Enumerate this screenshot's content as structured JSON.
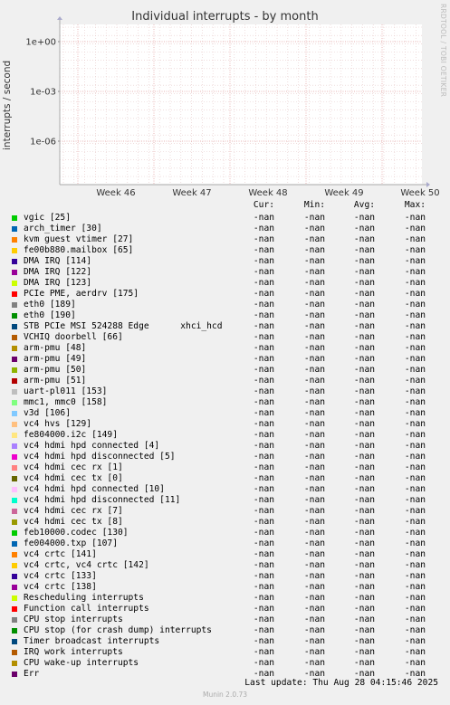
{
  "chart_data": {
    "type": "line",
    "title": "Individual interrupts - by month",
    "ylabel": "interrupts / second",
    "yscale": "log",
    "y_ticks": [
      "1e+00",
      "1e-03",
      "1e-06"
    ],
    "x_ticks": [
      "Week 46",
      "Week 47",
      "Week 48",
      "Week 49",
      "Week 50"
    ],
    "grid": true,
    "series": []
  },
  "side_label": "RRDTOOL / TOBI OETIKER",
  "legend_headers": [
    "Cur:",
    "Min:",
    "Avg:",
    "Max:"
  ],
  "legend": [
    {
      "name": "vgic [25]",
      "color": "#00cc00",
      "cur": "-nan",
      "min": "-nan",
      "avg": "-nan",
      "max": "-nan"
    },
    {
      "name": "arch_timer [30]",
      "color": "#0066b3",
      "cur": "-nan",
      "min": "-nan",
      "avg": "-nan",
      "max": "-nan"
    },
    {
      "name": "kvm guest vtimer [27]",
      "color": "#ff8000",
      "cur": "-nan",
      "min": "-nan",
      "avg": "-nan",
      "max": "-nan"
    },
    {
      "name": "fe00b880.mailbox [65]",
      "color": "#ffcc00",
      "cur": "-nan",
      "min": "-nan",
      "avg": "-nan",
      "max": "-nan"
    },
    {
      "name": "DMA IRQ [114]",
      "color": "#330099",
      "cur": "-nan",
      "min": "-nan",
      "avg": "-nan",
      "max": "-nan"
    },
    {
      "name": "DMA IRQ [122]",
      "color": "#990099",
      "cur": "-nan",
      "min": "-nan",
      "avg": "-nan",
      "max": "-nan"
    },
    {
      "name": "DMA IRQ [123]",
      "color": "#ccff00",
      "cur": "-nan",
      "min": "-nan",
      "avg": "-nan",
      "max": "-nan"
    },
    {
      "name": "PCIe PME, aerdrv [175]",
      "color": "#ff0000",
      "cur": "-nan",
      "min": "-nan",
      "avg": "-nan",
      "max": "-nan"
    },
    {
      "name": "eth0 [189]",
      "color": "#808080",
      "cur": "-nan",
      "min": "-nan",
      "avg": "-nan",
      "max": "-nan"
    },
    {
      "name": "eth0 [190]",
      "color": "#008f00",
      "cur": "-nan",
      "min": "-nan",
      "avg": "-nan",
      "max": "-nan"
    },
    {
      "name": "STB PCIe MSI 524288 Edge      xhci_hcd",
      "color": "#00487d",
      "cur": "-nan",
      "min": "-nan",
      "avg": "-nan",
      "max": "-nan"
    },
    {
      "name": "VCHIQ doorbell [66]",
      "color": "#b35a00",
      "cur": "-nan",
      "min": "-nan",
      "avg": "-nan",
      "max": "-nan"
    },
    {
      "name": "arm-pmu [48]",
      "color": "#b38f00",
      "cur": "-nan",
      "min": "-nan",
      "avg": "-nan",
      "max": "-nan"
    },
    {
      "name": "arm-pmu [49]",
      "color": "#6b006b",
      "cur": "-nan",
      "min": "-nan",
      "avg": "-nan",
      "max": "-nan"
    },
    {
      "name": "arm-pmu [50]",
      "color": "#8fb300",
      "cur": "-nan",
      "min": "-nan",
      "avg": "-nan",
      "max": "-nan"
    },
    {
      "name": "arm-pmu [51]",
      "color": "#b30000",
      "cur": "-nan",
      "min": "-nan",
      "avg": "-nan",
      "max": "-nan"
    },
    {
      "name": "uart-pl011 [153]",
      "color": "#bebebe",
      "cur": "-nan",
      "min": "-nan",
      "avg": "-nan",
      "max": "-nan"
    },
    {
      "name": "mmc1, mmc0 [158]",
      "color": "#80ff80",
      "cur": "-nan",
      "min": "-nan",
      "avg": "-nan",
      "max": "-nan"
    },
    {
      "name": "v3d [106]",
      "color": "#80c9ff",
      "cur": "-nan",
      "min": "-nan",
      "avg": "-nan",
      "max": "-nan"
    },
    {
      "name": "vc4 hvs [129]",
      "color": "#ffc080",
      "cur": "-nan",
      "min": "-nan",
      "avg": "-nan",
      "max": "-nan"
    },
    {
      "name": "fe804000.i2c [149]",
      "color": "#ffe680",
      "cur": "-nan",
      "min": "-nan",
      "avg": "-nan",
      "max": "-nan"
    },
    {
      "name": "vc4 hdmi hpd connected [4]",
      "color": "#aa80ff",
      "cur": "-nan",
      "min": "-nan",
      "avg": "-nan",
      "max": "-nan"
    },
    {
      "name": "vc4 hdmi hpd disconnected [5]",
      "color": "#ee00cc",
      "cur": "-nan",
      "min": "-nan",
      "avg": "-nan",
      "max": "-nan"
    },
    {
      "name": "vc4 hdmi cec rx [1]",
      "color": "#ff8080",
      "cur": "-nan",
      "min": "-nan",
      "avg": "-nan",
      "max": "-nan"
    },
    {
      "name": "vc4 hdmi cec tx [0]",
      "color": "#666600",
      "cur": "-nan",
      "min": "-nan",
      "avg": "-nan",
      "max": "-nan"
    },
    {
      "name": "vc4 hdmi hpd connected [10]",
      "color": "#ffbfff",
      "cur": "-nan",
      "min": "-nan",
      "avg": "-nan",
      "max": "-nan"
    },
    {
      "name": "vc4 hdmi hpd disconnected [11]",
      "color": "#00ffcc",
      "cur": "-nan",
      "min": "-nan",
      "avg": "-nan",
      "max": "-nan"
    },
    {
      "name": "vc4 hdmi cec rx [7]",
      "color": "#cc6699",
      "cur": "-nan",
      "min": "-nan",
      "avg": "-nan",
      "max": "-nan"
    },
    {
      "name": "vc4 hdmi cec tx [8]",
      "color": "#999900",
      "cur": "-nan",
      "min": "-nan",
      "avg": "-nan",
      "max": "-nan"
    },
    {
      "name": "feb10000.codec [130]",
      "color": "#00cc00",
      "cur": "-nan",
      "min": "-nan",
      "avg": "-nan",
      "max": "-nan"
    },
    {
      "name": "fe004000.txp [107]",
      "color": "#0066b3",
      "cur": "-nan",
      "min": "-nan",
      "avg": "-nan",
      "max": "-nan"
    },
    {
      "name": "vc4 crtc [141]",
      "color": "#ff8000",
      "cur": "-nan",
      "min": "-nan",
      "avg": "-nan",
      "max": "-nan"
    },
    {
      "name": "vc4 crtc, vc4 crtc [142]",
      "color": "#ffcc00",
      "cur": "-nan",
      "min": "-nan",
      "avg": "-nan",
      "max": "-nan"
    },
    {
      "name": "vc4 crtc [133]",
      "color": "#330099",
      "cur": "-nan",
      "min": "-nan",
      "avg": "-nan",
      "max": "-nan"
    },
    {
      "name": "vc4 crtc [138]",
      "color": "#990099",
      "cur": "-nan",
      "min": "-nan",
      "avg": "-nan",
      "max": "-nan"
    },
    {
      "name": "Rescheduling interrupts",
      "color": "#ccff00",
      "cur": "-nan",
      "min": "-nan",
      "avg": "-nan",
      "max": "-nan"
    },
    {
      "name": "Function call interrupts",
      "color": "#ff0000",
      "cur": "-nan",
      "min": "-nan",
      "avg": "-nan",
      "max": "-nan"
    },
    {
      "name": "CPU stop interrupts",
      "color": "#808080",
      "cur": "-nan",
      "min": "-nan",
      "avg": "-nan",
      "max": "-nan"
    },
    {
      "name": "CPU stop (for crash dump) interrupts",
      "color": "#008f00",
      "cur": "-nan",
      "min": "-nan",
      "avg": "-nan",
      "max": "-nan"
    },
    {
      "name": "Timer broadcast interrupts",
      "color": "#00487d",
      "cur": "-nan",
      "min": "-nan",
      "avg": "-nan",
      "max": "-nan"
    },
    {
      "name": "IRQ work interrupts",
      "color": "#b35a00",
      "cur": "-nan",
      "min": "-nan",
      "avg": "-nan",
      "max": "-nan"
    },
    {
      "name": "CPU wake-up interrupts",
      "color": "#b38f00",
      "cur": "-nan",
      "min": "-nan",
      "avg": "-nan",
      "max": "-nan"
    },
    {
      "name": "Err",
      "color": "#6b006b",
      "cur": "-nan",
      "min": "-nan",
      "avg": "-nan",
      "max": "-nan"
    }
  ],
  "last_update": "Last update: Thu Aug 28 04:15:46 2025",
  "footer": "Munin 2.0.73"
}
